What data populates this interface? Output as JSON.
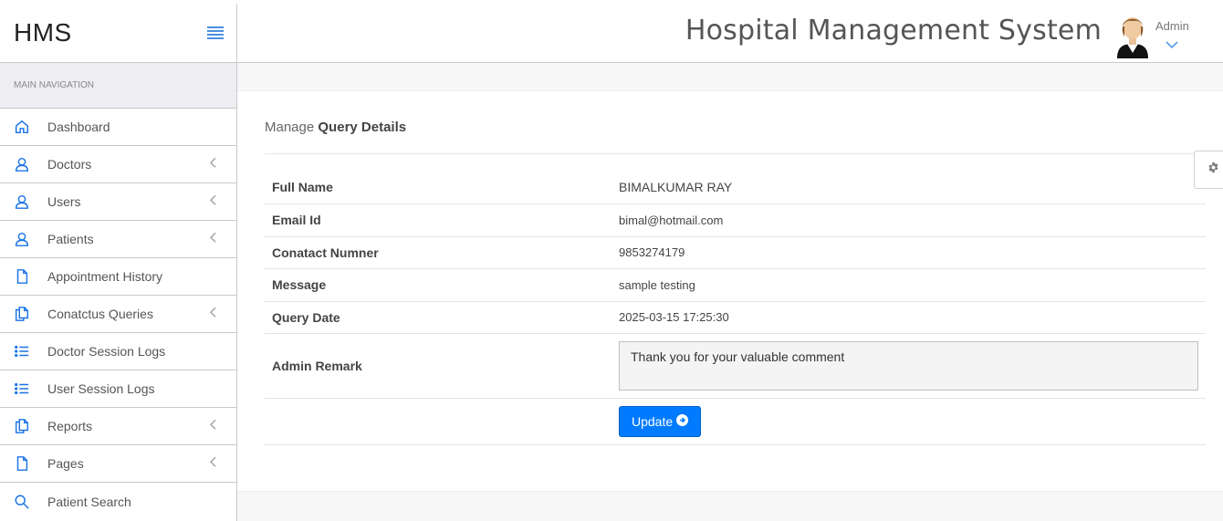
{
  "brand": {
    "text": "HMS"
  },
  "header": {
    "title": "Hospital Management System",
    "user_name": "Admin"
  },
  "sidebar": {
    "heading": "MAIN NAVIGATION",
    "items": [
      {
        "label": "Dashboard",
        "icon": "home-icon",
        "has_submenu": false
      },
      {
        "label": "Doctors",
        "icon": "user-icon",
        "has_submenu": true
      },
      {
        "label": "Users",
        "icon": "user-icon",
        "has_submenu": true
      },
      {
        "label": "Patients",
        "icon": "user-icon",
        "has_submenu": true
      },
      {
        "label": "Appointment History",
        "icon": "file-icon",
        "has_submenu": false
      },
      {
        "label": "Conatctus Queries",
        "icon": "files-icon",
        "has_submenu": true
      },
      {
        "label": "Doctor Session Logs",
        "icon": "list-icon",
        "has_submenu": false
      },
      {
        "label": "User Session Logs",
        "icon": "list-icon",
        "has_submenu": false
      },
      {
        "label": "Reports",
        "icon": "files-icon",
        "has_submenu": true
      },
      {
        "label": "Pages",
        "icon": "file-icon",
        "has_submenu": true
      },
      {
        "label": "Patient Search",
        "icon": "search-icon",
        "has_submenu": false
      }
    ]
  },
  "page": {
    "heading_prefix": "Manage",
    "heading_main": "Query Details",
    "details": [
      {
        "label": "Full Name",
        "value": "BIMALKUMAR RAY"
      },
      {
        "label": "Email Id",
        "value": "bimal@hotmail.com"
      },
      {
        "label": "Conatact Numner",
        "value": "9853274179"
      },
      {
        "label": "Message",
        "value": "sample testing"
      },
      {
        "label": "Query Date",
        "value": "2025-03-15 17:25:30"
      }
    ],
    "remark_label": "Admin Remark",
    "remark_value": "Thank you for your valuable comment",
    "update_label": "Update"
  },
  "colors": {
    "accent": "#007bff",
    "icon_blue": "#1a73e8"
  }
}
